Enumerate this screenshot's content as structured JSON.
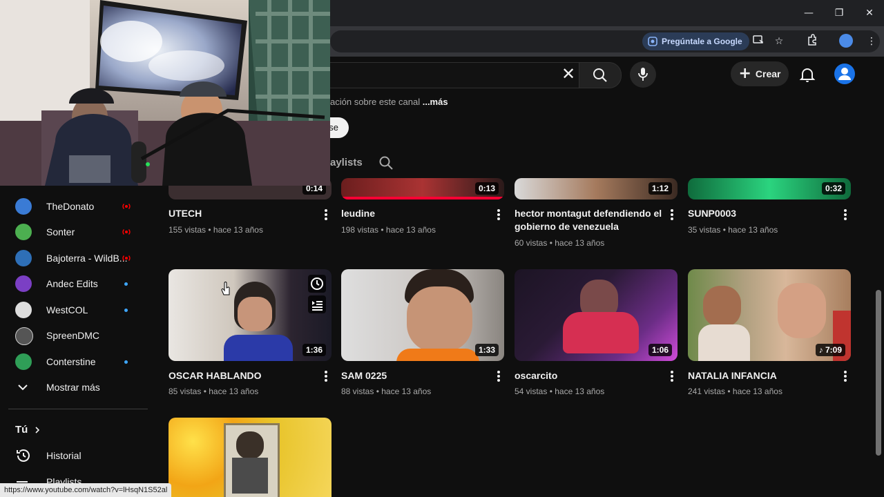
{
  "browser": {
    "ask_google": "Pregúntale a Google",
    "win_minimize": "—",
    "win_restore": "❐",
    "win_close": "✕"
  },
  "header": {
    "create_label": "Crear"
  },
  "channel": {
    "description_text": "ación sobre este canal",
    "more_label": "...más",
    "subscribe_fragment": "se",
    "tab_playlists_fragment": "aylists"
  },
  "sidebar": {
    "subscriptions": [
      {
        "name": "TheDonato",
        "indicator": "live",
        "avatar_color": "#3a7bd5"
      },
      {
        "name": "Sonter",
        "indicator": "live",
        "avatar_color": "#4caf50"
      },
      {
        "name": "Bajoterra - WildB...",
        "indicator": "live",
        "avatar_color": "#2e6fb7"
      },
      {
        "name": "Andec Edits",
        "indicator": "new",
        "avatar_color": "#7b3fc4"
      },
      {
        "name": "WestCOL",
        "indicator": "new",
        "avatar_color": "#dddddd"
      },
      {
        "name": "SpreenDMC",
        "indicator": "",
        "avatar_color": "#555555"
      },
      {
        "name": "Conterstine",
        "indicator": "new",
        "avatar_color": "#2f9e57"
      }
    ],
    "show_more": "Mostrar más",
    "you_label": "Tú",
    "history_label": "Historial",
    "playlists_label": "Playlists"
  },
  "videos_row1": [
    {
      "title": "UTECH",
      "meta": "155 vistas • hace 13 años",
      "duration": "0:14"
    },
    {
      "title": "leudine",
      "meta": "198 vistas • hace 13 años",
      "duration": "0:13"
    },
    {
      "title": "hector montagut defendiendo el gobierno de venezuela",
      "meta": "60 vistas • hace 13 años",
      "duration": "1:12"
    },
    {
      "title": "SUNP0003",
      "meta": "35 vistas • hace 13 años",
      "duration": "0:32"
    }
  ],
  "videos_row2": [
    {
      "title": "OSCAR HABLANDO",
      "meta": "85 vistas • hace 13 años",
      "duration": "1:36"
    },
    {
      "title": "SAM 0225",
      "meta": "88 vistas • hace 13 años",
      "duration": "1:33"
    },
    {
      "title": "oscarcito",
      "meta": "54 vistas • hace 13 años",
      "duration": "1:06"
    },
    {
      "title": "NATALIA INFANCIA",
      "meta": "241 vistas • hace 13 años",
      "duration": "♪ 7:09"
    }
  ],
  "status_url": "https://www.youtube.com/watch?v=lHsqN1S52al",
  "colors": {
    "background": "#0f0f0f",
    "accent_blue": "#3ea6ff",
    "live_red": "#ff0000"
  }
}
